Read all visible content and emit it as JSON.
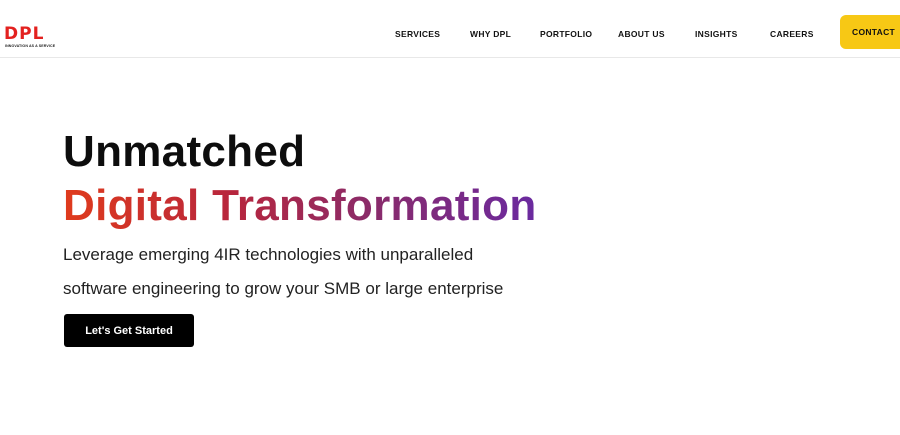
{
  "brand": {
    "logo_text": "DPL",
    "tagline": "INNOVATION AS A SERVICE",
    "logo_color": "#e3211f"
  },
  "nav": {
    "items": [
      {
        "label": "SERVICES"
      },
      {
        "label": "WHY DPL"
      },
      {
        "label": "PORTFOLIO"
      },
      {
        "label": "ABOUT US"
      },
      {
        "label": "INSIGHTS"
      },
      {
        "label": "CAREERS"
      }
    ],
    "contact_label": "CONTACT",
    "contact_color": "#f7c815"
  },
  "hero": {
    "title_line_1": "Unmatched",
    "title_line_2": "Digital Transformation",
    "description_line_1": "Leverage emerging 4IR technologies with unparalleled",
    "description_line_2": "software engineering to grow your SMB or large enterprise",
    "cta_label": "Let's Get Started",
    "gradient_colors": [
      "#e03b1c",
      "#b8263c",
      "#8a2b6a",
      "#6a2aa0"
    ]
  }
}
